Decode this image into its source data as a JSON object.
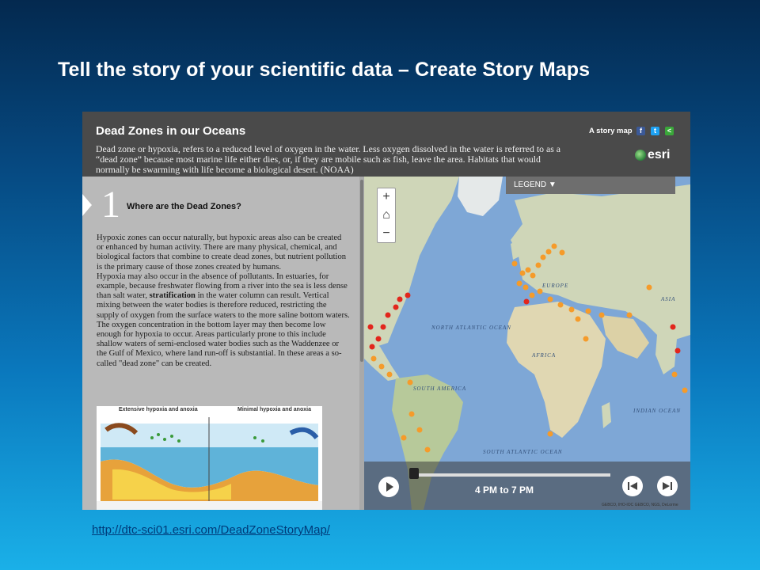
{
  "slide": {
    "title": "Tell the story of your scientific data – Create Story Maps",
    "url": "http://dtc-sci01.esri.com/DeadZoneStoryMap/"
  },
  "header": {
    "title": "Dead Zones in our Oceans",
    "description": "Dead zone or hypoxia, refers to a reduced level of oxygen in the water. Less oxygen dissolved in the water is referred to as a “dead zone” because most marine life either dies, or, if they are mobile such as fish, leave the area. Habitats that would normally be swarming with life become a biological desert. (NOAA)",
    "story_map_label": "A story map",
    "social": [
      "facebook-icon",
      "twitter-icon",
      "share-icon"
    ],
    "brand": "esri"
  },
  "panel": {
    "section_number": "1",
    "section_title": "Where are the Dead Zones?",
    "paragraph_1": "Hypoxic zones can occur naturally, but hypoxic areas also can be created or enhanced by human activity. There are many physical, chemical, and biological factors that combine to create dead zones, but nutrient pollution is the primary cause of those zones created by humans.",
    "paragraph_2_before": "Hypoxia may also occur in the absence of pollutants. In estuaries, for example, because freshwater flowing from a river into the sea is less dense than salt water, ",
    "paragraph_2_bold": "stratification",
    "paragraph_2_after": " in the water column can result. Vertical mixing between the water bodies is therefore reduced, restricting the supply of oxygen from the surface waters to the more saline bottom waters. The oxygen concentration in the bottom layer may then become low enough for hypoxia to occur. Areas particularly prone to this include shallow waters of semi-enclosed water bodies such as the Waddenzee or the Gulf of Mexico, where land run-off is substantial. In these areas a so-called \"dead zone\" can be created.",
    "figure": {
      "left_label": "Extensive hypoxia and anoxia",
      "right_label": "Minimal hypoxia and anoxia"
    }
  },
  "map": {
    "legend_label": "LEGEND ▼",
    "zoom_in": "+",
    "zoom_out": "−",
    "labels": {
      "europe": "EUROPE",
      "asia": "ASIA",
      "africa": "AFRICA",
      "north_atlantic": "NORTH ATLANTIC OCEAN",
      "south_america": "SOUTH AMERICA",
      "south_atlantic": "SOUTH ATLANTIC OCEAN",
      "indian": "INDIAN OCEAN"
    },
    "time_label": "4 PM to 7 PM",
    "attribution": "GEBCO, IHO-IOC GEBCO, NGS, DeLorme",
    "colors": {
      "ocean": "#7ea7d6",
      "land": "#cfd6b8",
      "dot_orange": "#f59b2a",
      "dot_red": "#e2261c"
    }
  }
}
